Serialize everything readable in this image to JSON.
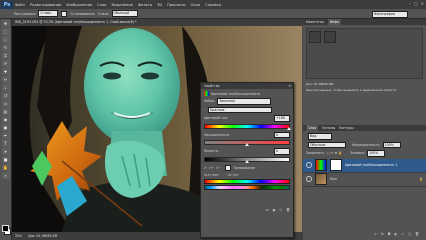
{
  "menubar": {
    "logo": "Ps",
    "items": [
      "Файл",
      "Редактирование",
      "Изображение",
      "Слои",
      "Выделение",
      "Фильтр",
      "3D",
      "Просмотр",
      "Окно",
      "Справка"
    ],
    "window_buttons": [
      "–",
      "□",
      "×"
    ]
  },
  "options": {
    "label": "Растушевка:",
    "feather_value": "0 пикс.",
    "antialias_label": "Сглаживание",
    "style_label": "Стиль:",
    "style_value": "Обычный",
    "workspace": "Фотография"
  },
  "document": {
    "tab_title": "IMG_5193.CR2 @ 33,3% (Цветовой тон/Насыщенность 1, Слой-маска/8) *",
    "status_zoom": "33%",
    "status_doc": "Док: 61,9М/65,8М"
  },
  "properties": {
    "title": "Свойства",
    "adjustment_name": "Цветовой тон/Насыщенность",
    "preset_label": "Набор:",
    "preset_value": "Заказная",
    "channel_value": "Красные",
    "hue_label": "Цветовой тон:",
    "hue_value": "+180",
    "saturation_label": "Насыщенность:",
    "saturation_value": "0",
    "lightness_label": "Яркость:",
    "lightness_value": "0",
    "colorize_label": "Тонирование",
    "range_values": [
      "315°/345°",
      "15°\\45°"
    ],
    "hue_fraction": 1.0,
    "saturation_fraction": 0.5,
    "lightness_fraction": 0.5
  },
  "right_panel": {
    "tabs": [
      "Навигатор",
      "Инфо"
    ],
    "info_text": "Щелчок мышью, чтобы выделить и выделенной области.",
    "doc_info": "Док: 61,9М/65,8М"
  },
  "layers": {
    "tabs": [
      "Слои",
      "Каналы",
      "Контуры"
    ],
    "kind_label": "Вид",
    "blend_mode": "Обычные",
    "opacity_label": "Непрозрачность:",
    "opacity_value": "100%",
    "lock_label": "Закрепить:",
    "fill_label": "Заливка:",
    "fill_value": "100%",
    "items": [
      {
        "name": "Цветовой тон/Насыщенность 1",
        "selected": true
      },
      {
        "name": "Фон",
        "selected": false
      }
    ]
  },
  "colors": {
    "accent": "#2f5a8c",
    "panel": "#535353"
  }
}
